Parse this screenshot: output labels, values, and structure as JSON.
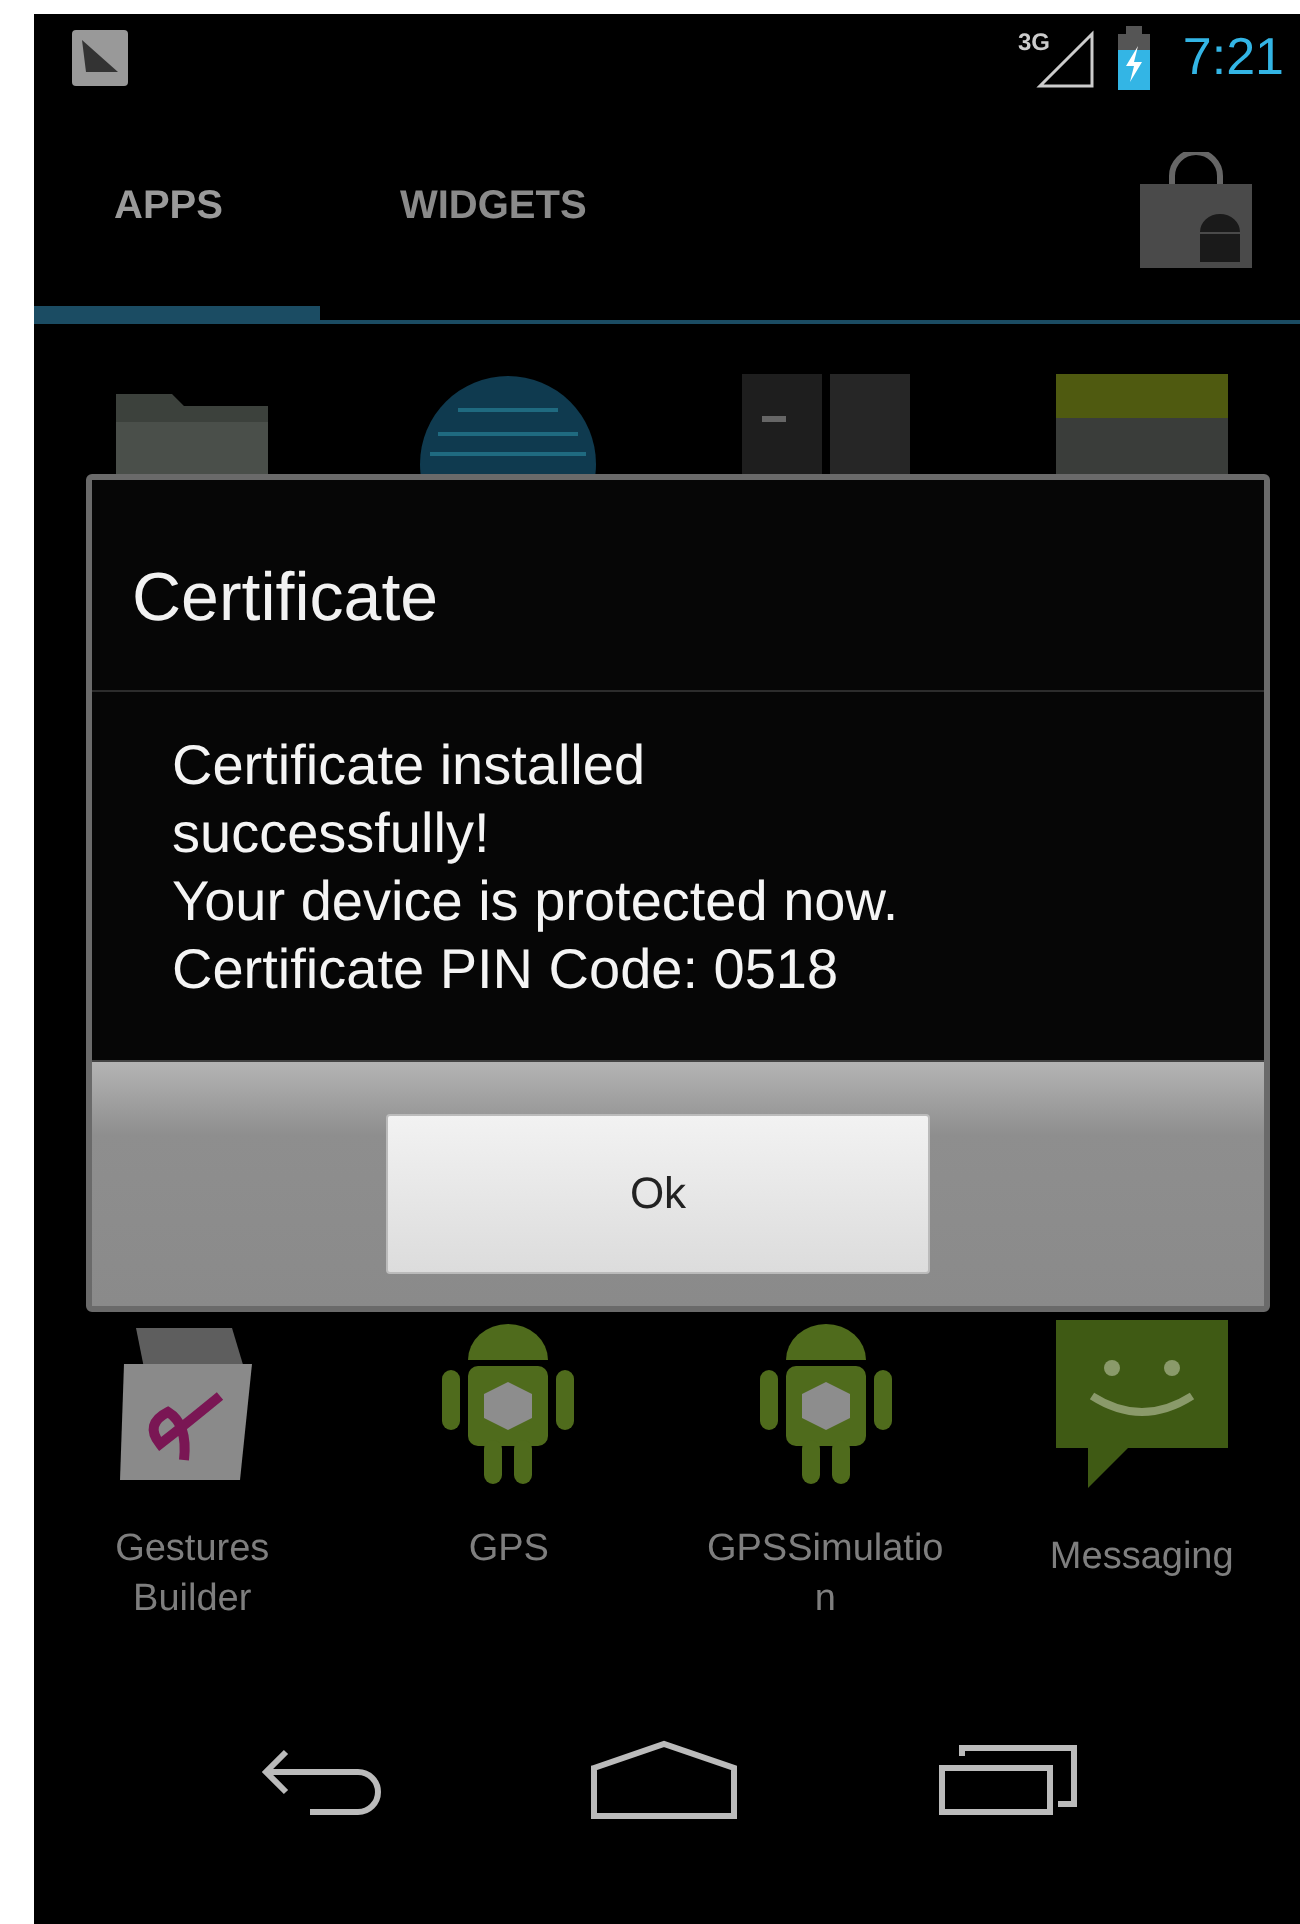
{
  "status_bar": {
    "network": "3G",
    "time": "7:21"
  },
  "tabs": [
    {
      "label": "APPS",
      "selected": true
    },
    {
      "label": "WIDGETS",
      "selected": false
    }
  ],
  "top_row_icons": [
    {
      "kind": "folder"
    },
    {
      "kind": "globe"
    },
    {
      "kind": "calculator"
    },
    {
      "kind": "calendar"
    }
  ],
  "dialog": {
    "title": "Certificate",
    "message": [
      "Certificate installed successfully!",
      "Your device is protected now.",
      "Certificate PIN Code: 0518"
    ],
    "button": "Ok"
  },
  "apps": [
    {
      "name": "Gestures Builder",
      "kind": "gestures"
    },
    {
      "name": "GPS",
      "kind": "android"
    },
    {
      "name": "GPSSimulatio n",
      "kind": "android"
    },
    {
      "name": "Messaging",
      "kind": "messaging"
    }
  ]
}
